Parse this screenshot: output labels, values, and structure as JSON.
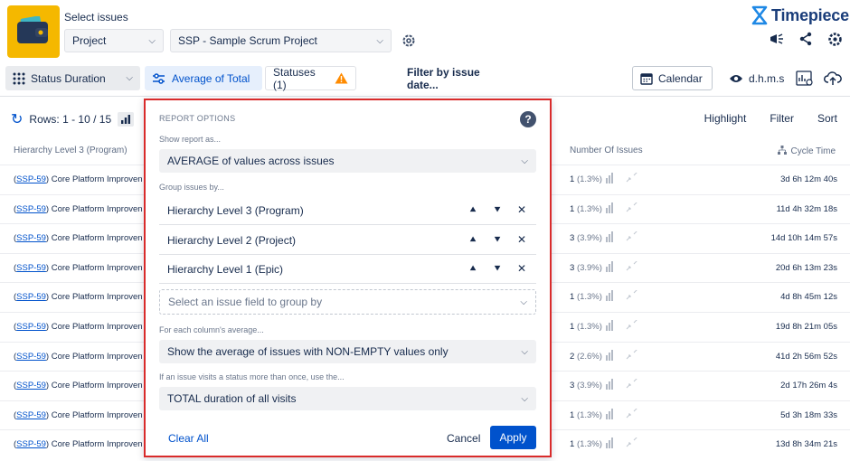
{
  "header": {
    "select_title": "Select issues",
    "project_dropdown": "Project",
    "scope_dropdown": "SSP - Sample Scrum Project",
    "brand": "Timepiece"
  },
  "toolbar": {
    "status_duration": "Status Duration",
    "average_of_total": "Average of Total",
    "statuses": "Statuses (1)",
    "filter_by_date": "Filter by issue date...",
    "calendar": "Calendar",
    "time_format": "d.h.m.s"
  },
  "table": {
    "rows_info": "Rows: 1 - 10 / 15",
    "actions": [
      "Highlight",
      "Filter",
      "Sort"
    ],
    "col_hierarchy": "Hierarchy Level 3 (Program)",
    "col_number": "Number Of Issues",
    "col_cycle": "Cycle Time",
    "rows": [
      {
        "key": "SSP-59",
        "summary": "Core Platform Improven",
        "count": "1",
        "pct": "(1.3%)",
        "cycle": "3d 6h 12m 40s"
      },
      {
        "key": "SSP-59",
        "summary": "Core Platform Improven",
        "count": "1",
        "pct": "(1.3%)",
        "cycle": "11d 4h 32m 18s"
      },
      {
        "key": "SSP-59",
        "summary": "Core Platform Improven",
        "count": "3",
        "pct": "(3.9%)",
        "cycle": "14d 10h 14m 57s"
      },
      {
        "key": "SSP-59",
        "summary": "Core Platform Improven",
        "count": "3",
        "pct": "(3.9%)",
        "cycle": "20d 6h 13m 23s"
      },
      {
        "key": "SSP-59",
        "summary": "Core Platform Improven",
        "count": "1",
        "pct": "(1.3%)",
        "cycle": "4d 8h 45m 12s"
      },
      {
        "key": "SSP-59",
        "summary": "Core Platform Improven",
        "count": "1",
        "pct": "(1.3%)",
        "cycle": "19d 8h 21m 05s"
      },
      {
        "key": "SSP-59",
        "summary": "Core Platform Improven",
        "count": "2",
        "pct": "(2.6%)",
        "cycle": "41d 2h 56m 52s"
      },
      {
        "key": "SSP-59",
        "summary": "Core Platform Improven",
        "count": "3",
        "pct": "(3.9%)",
        "cycle": "2d 17h 26m 4s"
      },
      {
        "key": "SSP-59",
        "summary": "Core Platform Improven",
        "count": "1",
        "pct": "(1.3%)",
        "cycle": "5d 3h 18m 33s"
      },
      {
        "key": "SSP-59",
        "summary": "Core Platform Improven",
        "count": "1",
        "pct": "(1.3%)",
        "cycle": "13d 8h 34m 21s"
      }
    ]
  },
  "panel": {
    "title": "REPORT OPTIONS",
    "show_as_label": "Show report as...",
    "show_as_value": "AVERAGE of values across issues",
    "group_label": "Group issues by...",
    "groups": [
      "Hierarchy Level 3 (Program)",
      "Hierarchy Level 2 (Project)",
      "Hierarchy Level 1 (Epic)"
    ],
    "group_placeholder": "Select an issue field to group by",
    "each_col_label": "For each column's average...",
    "each_col_value": "Show the average of issues with NON-EMPTY values only",
    "visits_label": "If an issue visits a status more than once, use the...",
    "visits_value": "TOTAL duration of all visits",
    "clear_all": "Clear All",
    "cancel": "Cancel",
    "apply": "Apply"
  },
  "colors": {
    "accent": "#0052cc",
    "logo": "#f5b800",
    "panel_border": "#d92b2b",
    "warning": "#ff8b00"
  }
}
